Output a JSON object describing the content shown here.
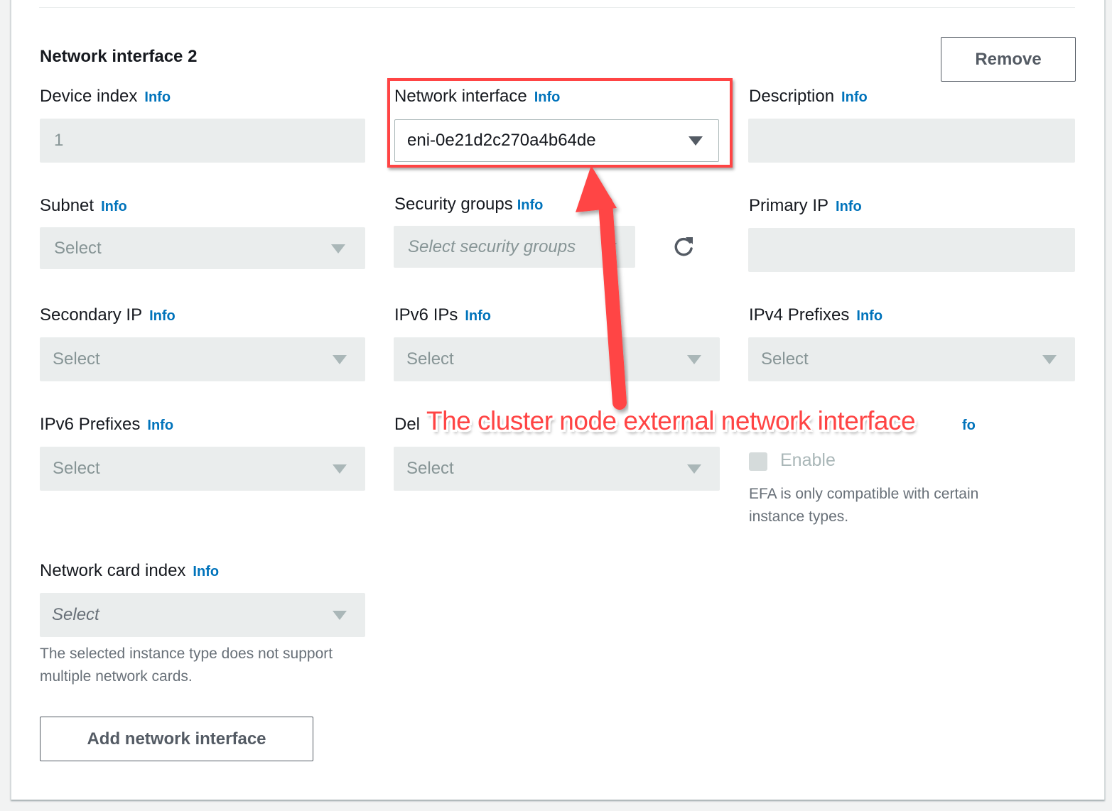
{
  "section": {
    "title": "Network interface 2",
    "remove_label": "Remove",
    "add_label": "Add network interface"
  },
  "info_label": "Info",
  "fields": {
    "device_index": {
      "label": "Device index",
      "value": "1"
    },
    "network_interface": {
      "label": "Network interface",
      "value": "eni-0e21d2c270a4b64de"
    },
    "description": {
      "label": "Description",
      "value": ""
    },
    "subnet": {
      "label": "Subnet",
      "placeholder": "Select"
    },
    "security_groups": {
      "label": "Security groups",
      "placeholder": "Select security groups"
    },
    "primary_ip": {
      "label": "Primary IP",
      "value": ""
    },
    "secondary_ip": {
      "label": "Secondary IP",
      "placeholder": "Select"
    },
    "ipv6_ips": {
      "label": "IPv6 IPs",
      "placeholder": "Select"
    },
    "ipv4_prefixes": {
      "label": "IPv4 Prefixes",
      "placeholder": "Select"
    },
    "ipv6_prefixes": {
      "label": "IPv6 Prefixes",
      "placeholder": "Select"
    },
    "delete_on_termination": {
      "label_fragment": "Del",
      "placeholder": "Select"
    },
    "efa": {
      "info_fragment": "fo",
      "checkbox_label": "Enable",
      "help": "EFA is only compatible with certain instance types."
    },
    "network_card_index": {
      "label": "Network card index",
      "placeholder": "Select",
      "help": "The selected instance type does not support multiple network cards."
    }
  },
  "annotation": {
    "text": "The cluster node external network interface",
    "color": "#ff4444"
  },
  "colors": {
    "link": "#0073bb",
    "disabled_input": "#eaeded",
    "text": "#16191f"
  }
}
